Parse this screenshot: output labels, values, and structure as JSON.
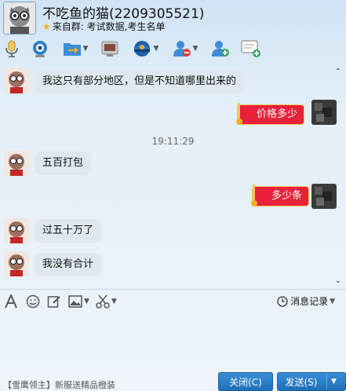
{
  "header": {
    "title": "不吃鱼的猫(2209305521)",
    "source_prefix": "来自群:",
    "source_name": "考试数据,考生名单"
  },
  "toolbar": {
    "items": [
      {
        "name": "voice-icon"
      },
      {
        "name": "video-icon"
      },
      {
        "name": "transfer-file-icon"
      },
      {
        "name": "remote-desktop-icon"
      },
      {
        "name": "app-icon"
      },
      {
        "name": "remove-user-icon"
      },
      {
        "name": "add-user-icon"
      },
      {
        "name": "message-add-icon"
      }
    ]
  },
  "messages": [
    {
      "side": "left",
      "text": "我这只有部分地区，但是不知道哪里出来的"
    },
    {
      "side": "right",
      "text": "价格多少"
    },
    {
      "type": "time",
      "text": "19:11:29"
    },
    {
      "side": "left",
      "text": "五百打包"
    },
    {
      "side": "right",
      "text": "多少条"
    },
    {
      "side": "left",
      "text": "过五十万了"
    },
    {
      "side": "left",
      "text": "我没有合计"
    }
  ],
  "input_toolbar": {
    "history_label": "消息记录"
  },
  "footer": {
    "ad_text": "【雪鹰领主】新服送精品橙装",
    "close_label": "关闭(C)",
    "send_label": "发送(S)"
  },
  "colors": {
    "accent": "#1f6fb8",
    "bubble_right": "#e8213a",
    "bubble_left": "#dfe8f0"
  }
}
